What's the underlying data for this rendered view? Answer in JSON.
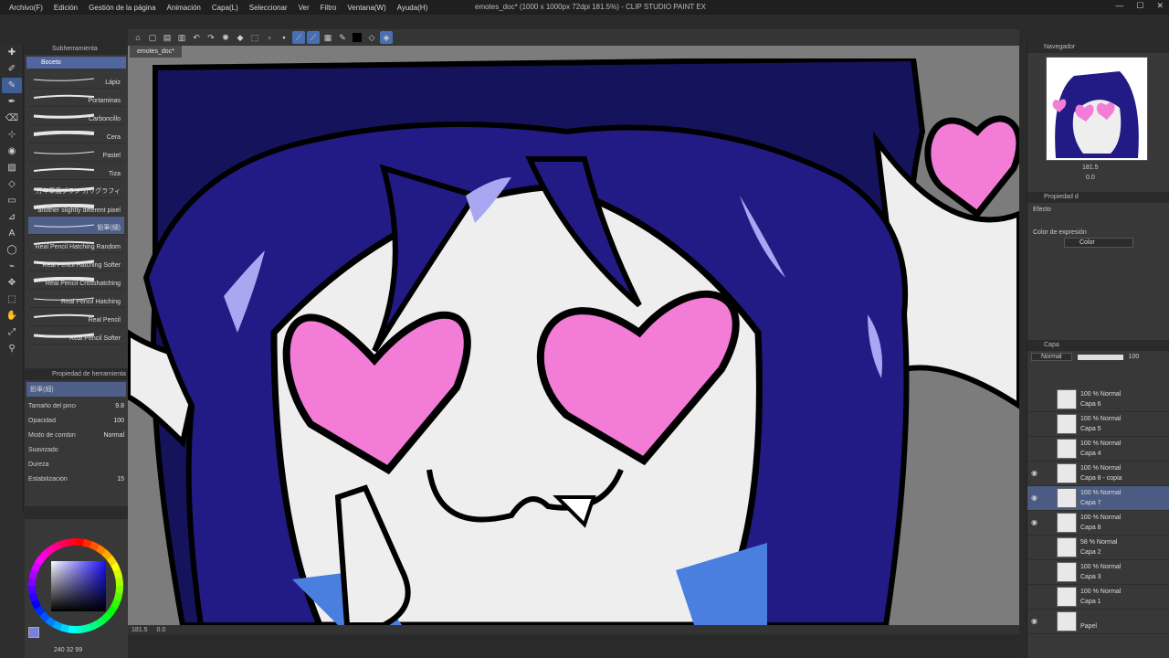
{
  "window": {
    "title": "emotes_doc* (1000 x 1000px 72dpi 181.5%) - CLIP STUDIO PAINT EX",
    "controls": [
      "—",
      "☐",
      "✕"
    ]
  },
  "menu": [
    "Archivo(F)",
    "Edición",
    "Gestión de la página",
    "Animación",
    "Capa(L)",
    "Seleccionar",
    "Ver",
    "Filtro",
    "Ventana(W)",
    "Ayuda(H)"
  ],
  "subtool": {
    "panel_title": "Subherramienta",
    "group": "Boceto",
    "brushes": [
      {
        "label": "Lápiz"
      },
      {
        "label": "Portaminas"
      },
      {
        "label": "Carboncillo"
      },
      {
        "label": "Cera"
      },
      {
        "label": "Pastel"
      },
      {
        "label": "Tiza"
      },
      {
        "label": "万年筆風ブラシ カリグラフィ"
      },
      {
        "label": "another slightly different pixel"
      },
      {
        "label": "鉛筆(細)"
      },
      {
        "label": "Real Pencil Hatching Random"
      },
      {
        "label": "Real Pencil Hatching Softer"
      },
      {
        "label": "Real Pencil Crosshatching"
      },
      {
        "label": "Real Pencil Hatching"
      },
      {
        "label": "Real Pencil"
      },
      {
        "label": "Real Pencil Softer"
      }
    ]
  },
  "toolprop": {
    "title": "Propiedad de herramienta",
    "current": "鉛筆(細)",
    "rows": [
      {
        "label": "Tamaño del pincel",
        "value": "9.8"
      },
      {
        "label": "Opacidad",
        "value": "100"
      },
      {
        "label": "Modo de combinac.",
        "value": "Normal"
      },
      {
        "label": "Suavizado",
        "value": ""
      },
      {
        "label": "Dureza",
        "value": ""
      },
      {
        "label": "Estabilización",
        "value": "15"
      }
    ]
  },
  "color": {
    "main": "#7b7fe0",
    "readout": "240 32 99"
  },
  "document": {
    "tab": "emotes_doc*",
    "zoom": "181.5",
    "angle": "0.0"
  },
  "navigator": {
    "title": "Navegador",
    "zoom": "181.5",
    "angle": "0.0"
  },
  "props": {
    "title": "Propiedad d",
    "section": "Efecto",
    "expr_label": "Color de expresión",
    "expr_value": "Color"
  },
  "layers": {
    "title": "Capa",
    "blend": "Normal",
    "opacity": "100",
    "items": [
      {
        "mode": "100 % Normal",
        "name": "Capa 6"
      },
      {
        "mode": "100 % Normal",
        "name": "Capa 5"
      },
      {
        "mode": "100 % Normal",
        "name": "Capa 4"
      },
      {
        "mode": "100 % Normal",
        "name": "Capa 8 - copia"
      },
      {
        "mode": "100 % Normal",
        "name": "Capa 7"
      },
      {
        "mode": "100 % Normal",
        "name": "Capa 8"
      },
      {
        "mode": "58 % Normal",
        "name": "Capa 2"
      },
      {
        "mode": "100 % Normal",
        "name": "Capa 3"
      },
      {
        "mode": "100 % Normal",
        "name": "Capa 1"
      },
      {
        "mode": "",
        "name": "Papel"
      }
    ]
  },
  "palette": {
    "hair": "#221b86",
    "hair_dark": "#14135c",
    "skin": "#eeeeee",
    "heart": "#f27cd6",
    "shine": "#a9a6f2",
    "scarf": "#4a7fe0",
    "bg": "#7c7c7c"
  }
}
